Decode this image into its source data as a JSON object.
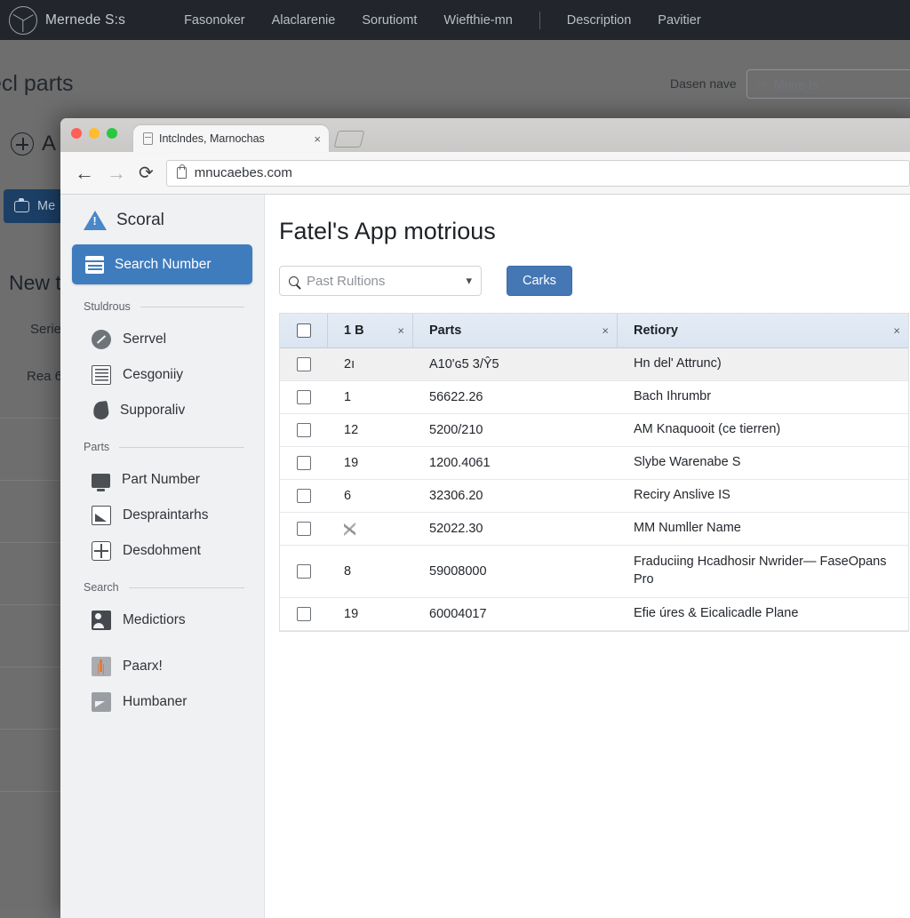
{
  "background_page": {
    "brand": {
      "name": "Mernede S:s",
      "logo_icon": "mercedes-star-icon"
    },
    "nav_links": [
      "Fasonoker",
      "Alaclarenie",
      "Sorutiomt",
      "Wiefthie-mn",
      "Description",
      "Pavitier"
    ],
    "page_title": "ecl parts",
    "right_label": "Dasen nave",
    "right_field_value": "Mone Is",
    "right_field_icon": "reply-arrow-icon",
    "section_icon_label": "A",
    "blue_button_label": "Me",
    "blue_button_icon": "camera-icon",
    "heading": "New to",
    "subline_1": "Serie",
    "subline_2": "Rea 6"
  },
  "browser": {
    "tab": {
      "title": "Intclndes, Marnochas",
      "favicon": "page-icon",
      "close_icon": "×"
    },
    "new_tab_icon": "new-tab-icon",
    "traffic_lights": {
      "close": "#ff5f57",
      "minimize": "#febc2e",
      "maximize": "#28c840"
    },
    "back_icon": "←",
    "forward_icon": "→",
    "reload_icon": "⟳",
    "url": "mnucaebes.com",
    "lock_icon": "lock-icon"
  },
  "sidebar": {
    "logo": {
      "label": "Scoral",
      "icon": "warning-triangle-icon"
    },
    "active_item": {
      "label": "Search Number",
      "icon": "list-icon"
    },
    "groups": [
      {
        "title": "Stuldrous",
        "items": [
          {
            "label": "Serrvel",
            "icon": "disk-icon"
          },
          {
            "label": "Cesgoniiy",
            "icon": "ledger-icon"
          },
          {
            "label": "Supporaliv",
            "icon": "flame-icon"
          }
        ]
      },
      {
        "title": "Parts",
        "items": [
          {
            "label": "Part Number",
            "icon": "monitor-icon"
          },
          {
            "label": "Despraintarhs",
            "icon": "chart-box-icon"
          },
          {
            "label": "Desdohment",
            "icon": "target-icon"
          }
        ]
      },
      {
        "title": "Search",
        "items": [
          {
            "label": "Medictiors",
            "icon": "people-icon"
          },
          {
            "label": "Paarx!",
            "icon": "upload-icon"
          },
          {
            "label": "Humbaner",
            "icon": "image-icon"
          }
        ]
      }
    ]
  },
  "main": {
    "title": "Fatel's App motrious",
    "filter": {
      "value": "Past Rultions",
      "search_icon": "search-icon",
      "chevron_icon": "chevron-down-icon"
    },
    "search_button": "Carks",
    "table": {
      "header_checkbox": "checkbox-icon",
      "columns": [
        "",
        "1 B",
        "Parts",
        "Retiory"
      ],
      "column_close_icon": "×",
      "rows": [
        {
          "qty": "2ı",
          "part": "A10'ɢ5 3/Ŷ5",
          "factory": "Hn del' Attrunc)",
          "selected": true
        },
        {
          "qty": "1",
          "part": "56622.26",
          "factory": "Bach Ihrumbr",
          "selected": false
        },
        {
          "qty": "12",
          "part": "5200/210",
          "factory": "AM Knaquooit (ce tierren)",
          "selected": false
        },
        {
          "qty": "19",
          "part": "1200.4061",
          "factory": "Slybe Warenabe S",
          "selected": false
        },
        {
          "qty": "6",
          "part": "32306.20",
          "factory": "Reciry Anslive IS",
          "selected": false
        },
        {
          "qty": "",
          "part": "52022.30",
          "factory": "MM Numller Name",
          "selected": false,
          "smudged_qty": true
        },
        {
          "qty": "8",
          "part": "59008000",
          "factory": "Fraduciing Hcadhosir Nwrider— FaseOpans Pro",
          "selected": false,
          "tall": true
        },
        {
          "qty": "19",
          "part": "60004017",
          "factory": "Efie úres & Eicalicadle Plane",
          "selected": false
        }
      ]
    }
  },
  "colors": {
    "topbar_dark": "#22262c",
    "accent_blue": "#4477b4",
    "sidebar_active_blue": "#3f7cbe",
    "table_header_blue": "#dbe5f1",
    "background_dim": "#6e6e6e"
  }
}
